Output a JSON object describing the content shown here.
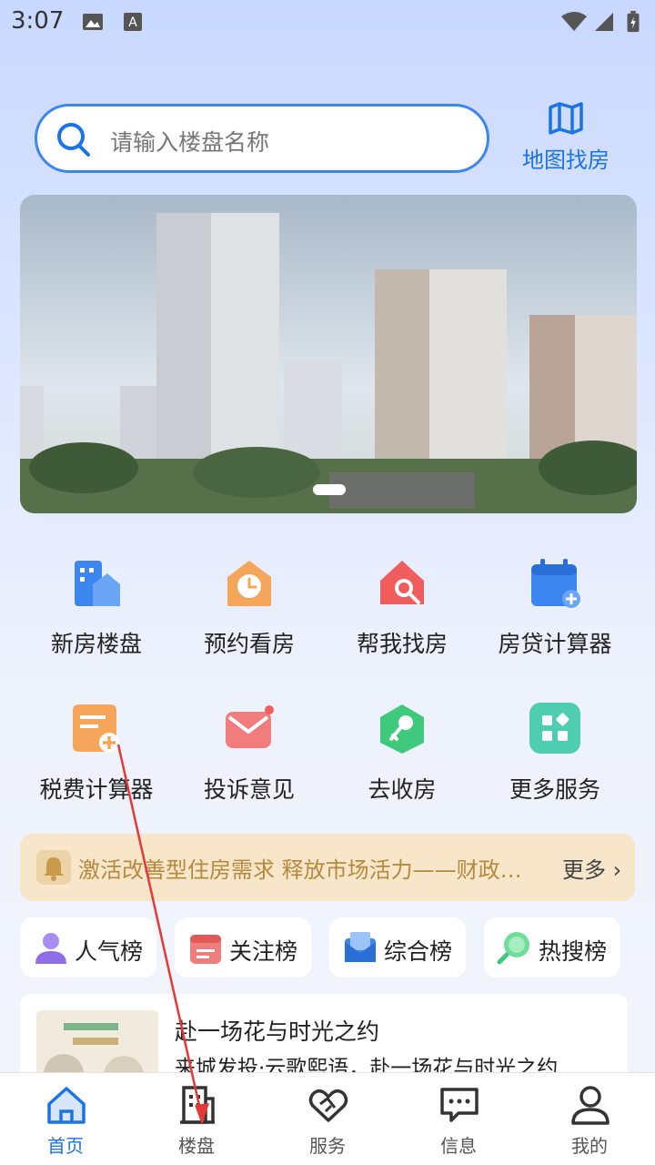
{
  "status_bar": {
    "time": "3:07"
  },
  "search": {
    "placeholder": "请输入楼盘名称",
    "map_label": "地图找房"
  },
  "services": [
    {
      "label": "新房楼盘"
    },
    {
      "label": "预约看房"
    },
    {
      "label": "帮我找房"
    },
    {
      "label": "房贷计算器"
    },
    {
      "label": "税费计算器"
    },
    {
      "label": "投诉意见"
    },
    {
      "label": "去收房"
    },
    {
      "label": "更多服务"
    }
  ],
  "notice": {
    "text": "激活改善型住房需求 释放市场活力——财政部税务总局住建部",
    "more_label": "更多"
  },
  "ranks": [
    {
      "label": "人气榜"
    },
    {
      "label": "关注榜"
    },
    {
      "label": "综合榜"
    },
    {
      "label": "热搜榜"
    }
  ],
  "news": {
    "title": "赴一场花与时光之约",
    "subtitle": "来城发投·云歌熙语，赴一场花与时光之约"
  },
  "bottom_nav": [
    {
      "label": "首页",
      "active": true
    },
    {
      "label": "楼盘"
    },
    {
      "label": "服务"
    },
    {
      "label": "信息"
    },
    {
      "label": "我的"
    }
  ],
  "colors": {
    "accent": "#1a73e8",
    "notice_bg": "#f7e6c9",
    "notice_text": "#b58a3e"
  }
}
